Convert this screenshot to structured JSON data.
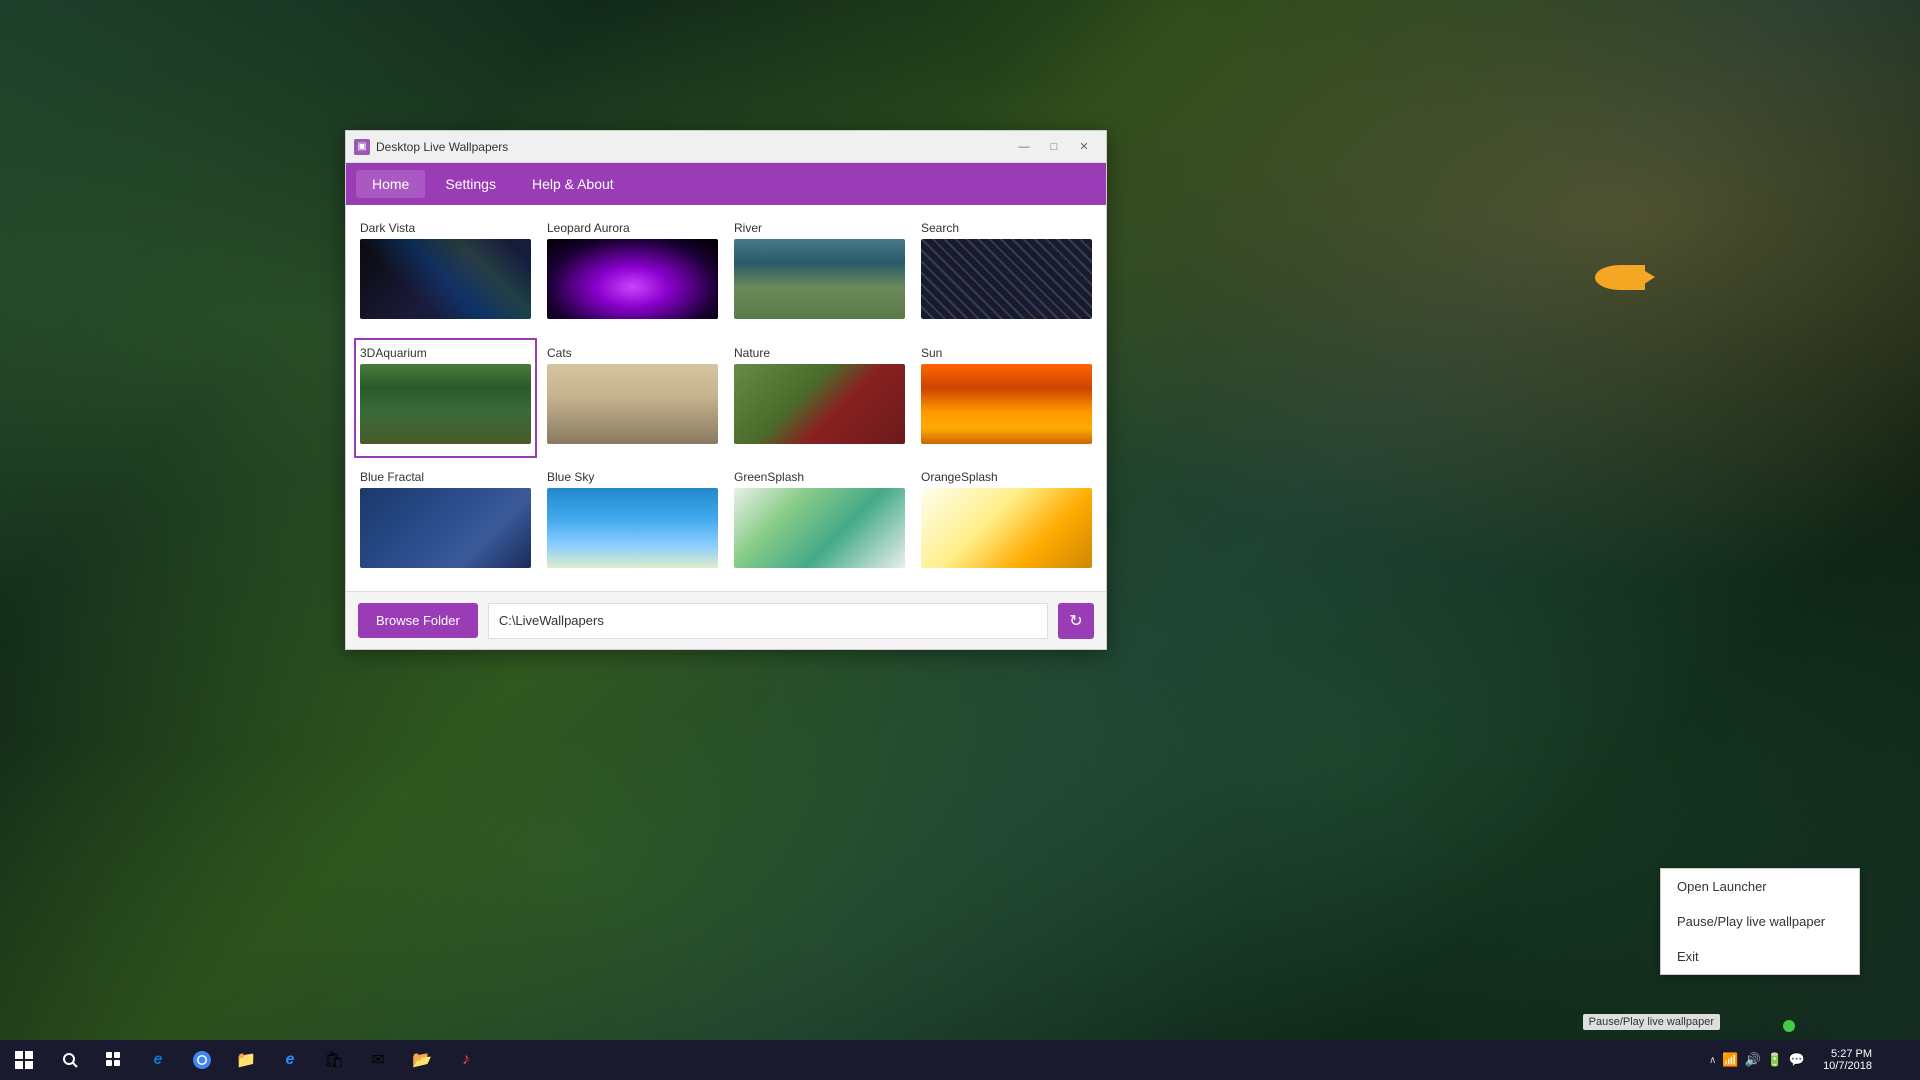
{
  "desktop": {
    "background_desc": "Aquarium desktop background"
  },
  "app_window": {
    "title": "Desktop Live Wallpapers",
    "icon": "▣"
  },
  "title_bar": {
    "minimize_label": "—",
    "maximize_label": "□",
    "close_label": "✕"
  },
  "menu": {
    "items": [
      {
        "id": "home",
        "label": "Home",
        "active": true
      },
      {
        "id": "settings",
        "label": "Settings",
        "active": false
      },
      {
        "id": "help",
        "label": "Help & About",
        "active": false
      }
    ]
  },
  "wallpapers": [
    {
      "id": "dark-vista",
      "label": "Dark Vista",
      "thumb_class": "thumb-dark-vista"
    },
    {
      "id": "leopard-aurora",
      "label": "Leopard Aurora",
      "thumb_class": "thumb-leopard-aurora"
    },
    {
      "id": "river",
      "label": "River",
      "thumb_class": "thumb-river"
    },
    {
      "id": "search",
      "label": "Search",
      "thumb_class": "thumb-search"
    },
    {
      "id": "3daquarium",
      "label": "3DAquarium",
      "thumb_class": "thumb-3daquarium",
      "selected": true
    },
    {
      "id": "cats",
      "label": "Cats",
      "thumb_class": "thumb-cats"
    },
    {
      "id": "nature",
      "label": "Nature",
      "thumb_class": "thumb-nature"
    },
    {
      "id": "sun",
      "label": "Sun",
      "thumb_class": "thumb-sun"
    },
    {
      "id": "blue-fractal",
      "label": "Blue Fractal",
      "thumb_class": "thumb-blue-fractal"
    },
    {
      "id": "blue-sky",
      "label": "Blue Sky",
      "thumb_class": "thumb-blue-sky"
    },
    {
      "id": "greensplash",
      "label": "GreenSplash",
      "thumb_class": "thumb-greensplash"
    },
    {
      "id": "orangesplash",
      "label": "OrangeSplash",
      "thumb_class": "thumb-orangesplash"
    }
  ],
  "bottom_bar": {
    "browse_folder_label": "Browse Folder",
    "folder_path": "C:\\LiveWallpapers",
    "refresh_icon": "↻"
  },
  "context_menu": {
    "items": [
      {
        "id": "open-launcher",
        "label": "Open Launcher"
      },
      {
        "id": "pause-play",
        "label": "Pause/Play live wallpaper"
      },
      {
        "id": "exit",
        "label": "Exit"
      }
    ]
  },
  "taskbar": {
    "start_icon": "⊞",
    "search_icon": "○",
    "task_view_icon": "⧉",
    "apps": [
      {
        "id": "edge",
        "icon": "e",
        "color": "#0078d4"
      },
      {
        "id": "chrome",
        "icon": "⬤",
        "color": "#4285f4"
      },
      {
        "id": "files",
        "icon": "📁",
        "color": "#ffc107"
      },
      {
        "id": "ie",
        "icon": "e",
        "color": "#1e90ff"
      },
      {
        "id": "store",
        "icon": "🛍",
        "color": "#0078d4"
      },
      {
        "id": "mail",
        "icon": "✉",
        "color": "#0078d4"
      },
      {
        "id": "folder2",
        "icon": "📂",
        "color": "#ffc107"
      },
      {
        "id": "itunes",
        "icon": "♪",
        "color": "#fc3c44"
      }
    ],
    "time": "5:27 PM",
    "date": "10/7/2018",
    "tray_icons": [
      "^",
      "⊡",
      "🔊",
      "📶",
      "🔋"
    ]
  },
  "pause_play_label": "Pause/Play live wallpaper",
  "colors": {
    "accent": "#9b3cb7",
    "menu_bg": "#9b3cb7",
    "taskbar_bg": "#1a1a2e"
  }
}
